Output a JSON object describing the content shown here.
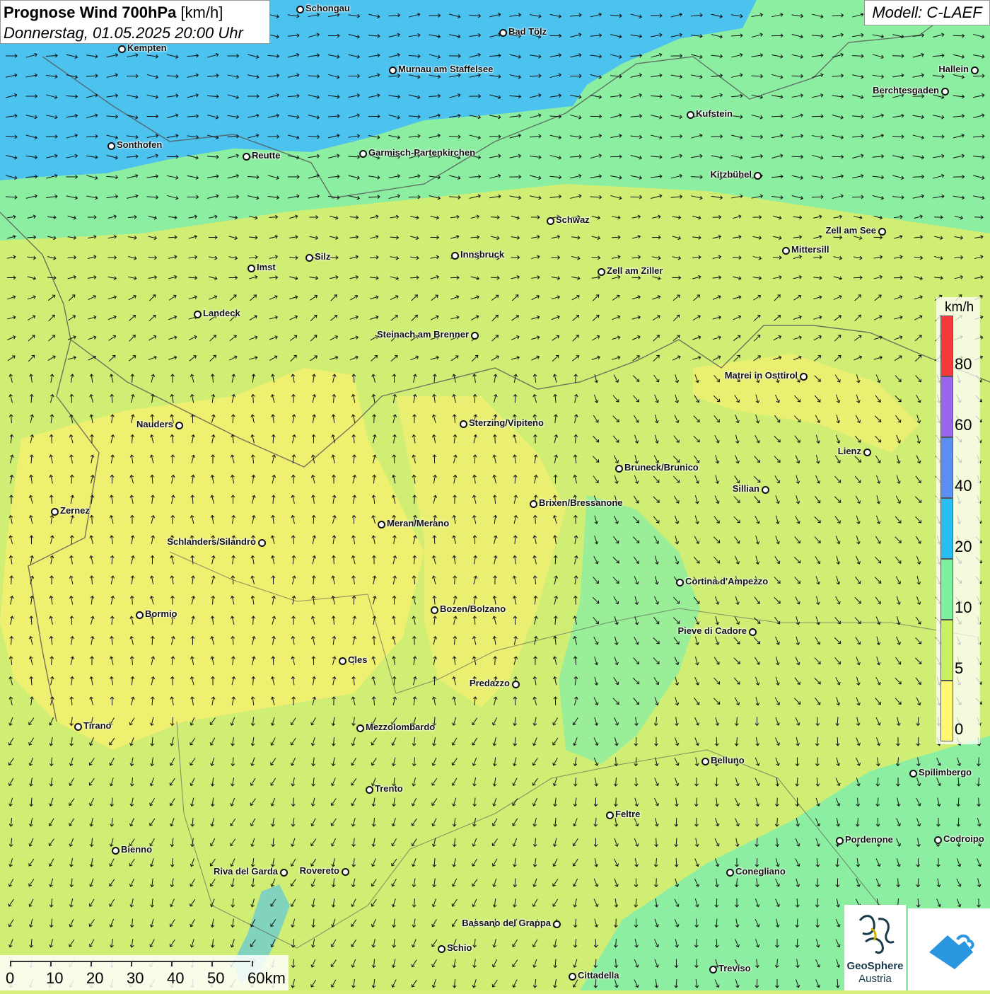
{
  "title": {
    "main": "Prognose Wind 700hPa",
    "unit": "[km/h]",
    "date": "Donnerstag, 01.05.2025 20:00 Uhr"
  },
  "model": "Modell: C-LAEF",
  "legend": {
    "unit": "km/h",
    "labels": [
      "80",
      "60",
      "40",
      "20",
      "10",
      "5",
      "0"
    ],
    "colors": [
      "#f53a3a",
      "#9966ee",
      "#5a8ef0",
      "#28bff0",
      "#7ff0a0",
      "#c8f060",
      "#fff870"
    ]
  },
  "scale": {
    "labels": [
      "0",
      "10",
      "20",
      "30",
      "40",
      "50",
      "60km"
    ]
  },
  "logos": {
    "geosphere_line1": "GeoSphere",
    "geosphere_line2": "Austria"
  },
  "colors": {
    "low_wind": "#f4ef70",
    "mid_wind": "#c6ef6e",
    "high_wind": "#8ceea0",
    "strong_wind": "#4fc4ee"
  },
  "cities": [
    "Schongau",
    "Bad Tölz",
    "Kempten",
    "Murnau am Staffelsee",
    "Hallein",
    "Berchtesgaden",
    "Kufstein",
    "Sonthofen",
    "Reutte",
    "Garmisch-Partenkirchen",
    "Kitzbühel",
    "Schwaz",
    "Zell am See",
    "Innsbruck",
    "Silz",
    "Mittersill",
    "Imst",
    "Zell am Ziller",
    "Landeck",
    "Steinach am Brenner",
    "Matrei in Osttirol",
    "Nauders",
    "Sterzing/Vipiteno",
    "Lienz",
    "Bruneck/Brunico",
    "Sillian",
    "Zernez",
    "Brixen/Bressanone",
    "Meran/Merano",
    "Schlanders/Silandro",
    "Cortina d'Ampezzo",
    "Bormio",
    "Bozen/Bolzano",
    "Pieve di Cadore",
    "Cles",
    "Predazzo",
    "Tirano",
    "Mezzolombardo",
    "Belluno",
    "Spilimbergo",
    "Trento",
    "Feltre",
    "Pordenone",
    "Codroipo",
    "Bienno",
    "Riva del Garda",
    "Rovereto",
    "Conegliano",
    "Bassano del Grappa",
    "Schio",
    "Treviso",
    "Cittadella"
  ]
}
